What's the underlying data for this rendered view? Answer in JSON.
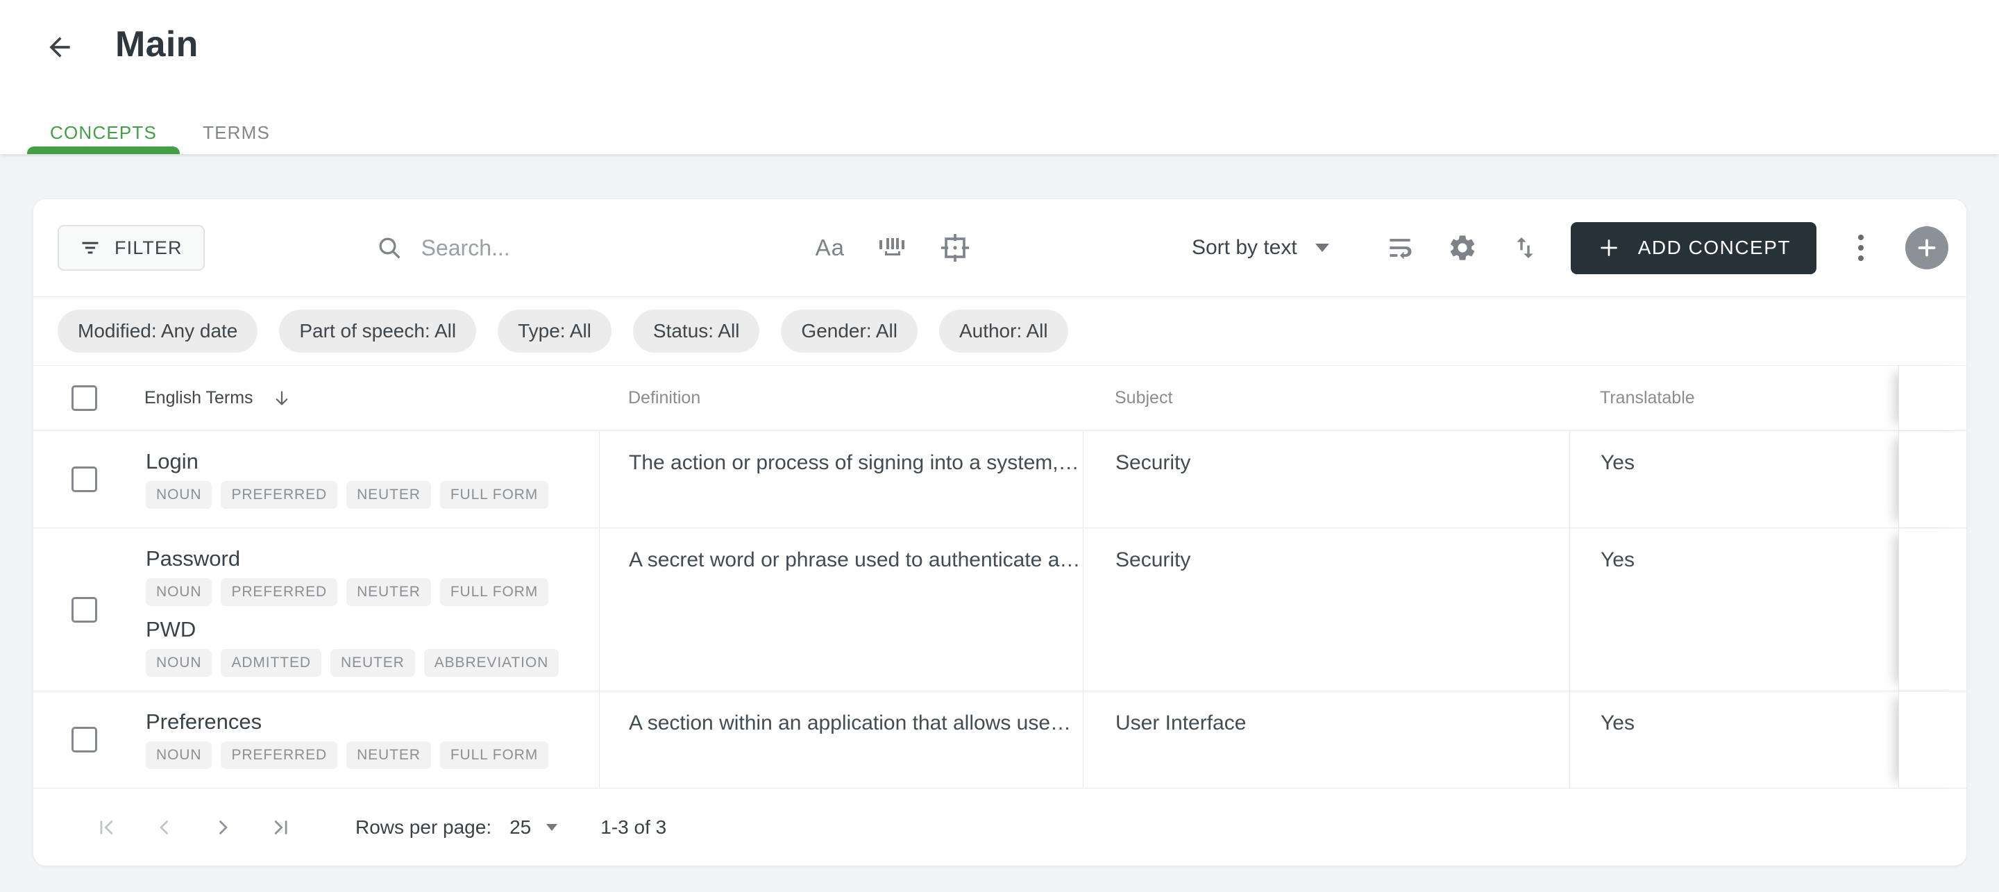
{
  "header": {
    "title": "Main"
  },
  "tabs": {
    "concepts": "CONCEPTS",
    "terms": "TERMS",
    "active_tab": "CONCEPTS"
  },
  "toolbar": {
    "filter_label": "FILTER",
    "search_placeholder": "Search...",
    "match_case_label": "Aa",
    "sort_label": "Sort by text",
    "add_concept_label": "ADD CONCEPT",
    "icon_names": [
      "filter-lines",
      "magnifier",
      "match-case",
      "whole-word",
      "exact-target",
      "sort-caret",
      "wrap-text",
      "settings-gear",
      "swap-vertical",
      "plus",
      "more-vertical",
      "add-circle"
    ]
  },
  "filter_chips": [
    "Modified: Any date",
    "Part of speech: All",
    "Type: All",
    "Status: All",
    "Gender: All",
    "Author: All"
  ],
  "table": {
    "columns": {
      "terms": "English Terms",
      "definition": "Definition",
      "subject": "Subject",
      "translatable": "Translatable"
    },
    "sorted_column": "English Terms",
    "rows": [
      {
        "terms": [
          {
            "name": "Login",
            "tags": [
              "NOUN",
              "PREFERRED",
              "NEUTER",
              "FULL FORM"
            ]
          }
        ],
        "definition": "The action or process of signing into a system,…",
        "subject": "Security",
        "translatable": "Yes"
      },
      {
        "terms": [
          {
            "name": "Password",
            "tags": [
              "NOUN",
              "PREFERRED",
              "NEUTER",
              "FULL FORM"
            ]
          },
          {
            "name": "PWD",
            "tags": [
              "NOUN",
              "ADMITTED",
              "NEUTER",
              "ABBREVIATION"
            ]
          }
        ],
        "definition": "A secret word or phrase used to authenticate a…",
        "subject": "Security",
        "translatable": "Yes"
      },
      {
        "terms": [
          {
            "name": "Preferences",
            "tags": [
              "NOUN",
              "PREFERRED",
              "NEUTER",
              "FULL FORM"
            ]
          }
        ],
        "definition": "A section within an application that allows use…",
        "subject": "User Interface",
        "translatable": "Yes"
      }
    ]
  },
  "pagination": {
    "rows_per_page_label": "Rows per page:",
    "rows_per_page_value": "25",
    "range": "1-3 of 3"
  },
  "colors": {
    "accent_green": "#43a047",
    "primary_dark": "#263238"
  }
}
